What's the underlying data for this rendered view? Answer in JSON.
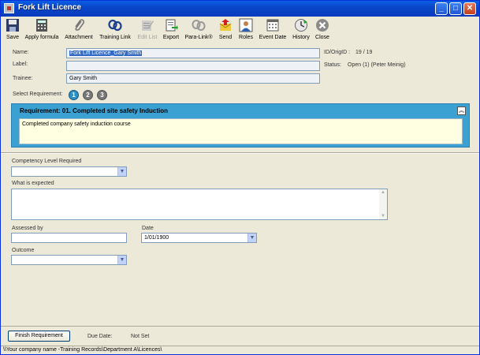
{
  "window": {
    "title": "Fork Lift Licence",
    "controls": {
      "minimize": "_",
      "maximize": "□",
      "close": "✕"
    }
  },
  "toolbar": {
    "items": [
      {
        "label": "Save",
        "icon": "save-icon",
        "enabled": true
      },
      {
        "label": "Apply formula",
        "icon": "calculator-icon",
        "enabled": true
      },
      {
        "label": "Attachment",
        "icon": "paperclip-icon",
        "enabled": true
      },
      {
        "label": "Training Link",
        "icon": "chain-link-icon",
        "enabled": true
      },
      {
        "label": "Edit List",
        "icon": "edit-list-icon",
        "enabled": false
      },
      {
        "label": "Export",
        "icon": "export-icon",
        "enabled": true
      },
      {
        "label": "Para-Link®",
        "icon": "para-link-icon",
        "enabled": true
      },
      {
        "label": "Send",
        "icon": "send-icon",
        "enabled": true
      },
      {
        "label": "Roles",
        "icon": "roles-icon",
        "enabled": true
      },
      {
        "label": "Event Date",
        "icon": "calendar-icon",
        "enabled": true
      },
      {
        "label": "History",
        "icon": "history-icon",
        "enabled": true
      },
      {
        "label": "Close",
        "icon": "close-icon",
        "enabled": true
      }
    ]
  },
  "form": {
    "name_label": "Name:",
    "name_value": "Fork Lift Licence_Gary Smith",
    "label_label": "Label:",
    "label_value": "",
    "trainee_label": "Trainee:",
    "trainee_value": "Gary Smith",
    "id_label": "ID/OrigID :",
    "id_value": "19 / 19",
    "status_label": "Status:",
    "status_value": "Open (1) (Peter Meinig)",
    "select_req_label": "Select Requirement:",
    "steps": [
      "1",
      "2",
      "3"
    ],
    "active_step": "1"
  },
  "requirement": {
    "heading": "Requirement:  01. Completed site safety Induction",
    "collapse_glyph": "︽",
    "description": "Completed company safety induction course"
  },
  "details": {
    "competency_label": "Competency Level Required",
    "competency_value": "",
    "expected_label": "What is expected",
    "expected_value": "",
    "assessed_label": "Assessed by",
    "assessed_value": "",
    "date_label": "Date",
    "date_value": "1/01/1900",
    "outcome_label": "Outcome",
    "outcome_value": ""
  },
  "footer": {
    "finish_label": "Finish Requirement",
    "due_label": "Due Date:",
    "due_value": "Not Set"
  },
  "statusbar": {
    "path": "\\\\Your company name -Training Records\\Department A\\Licences\\"
  },
  "colors": {
    "titlebar": "#0a5fe5",
    "requirement_panel": "#3aa1d2",
    "description_bg": "#ffffe1",
    "selection": "#316ac5"
  }
}
